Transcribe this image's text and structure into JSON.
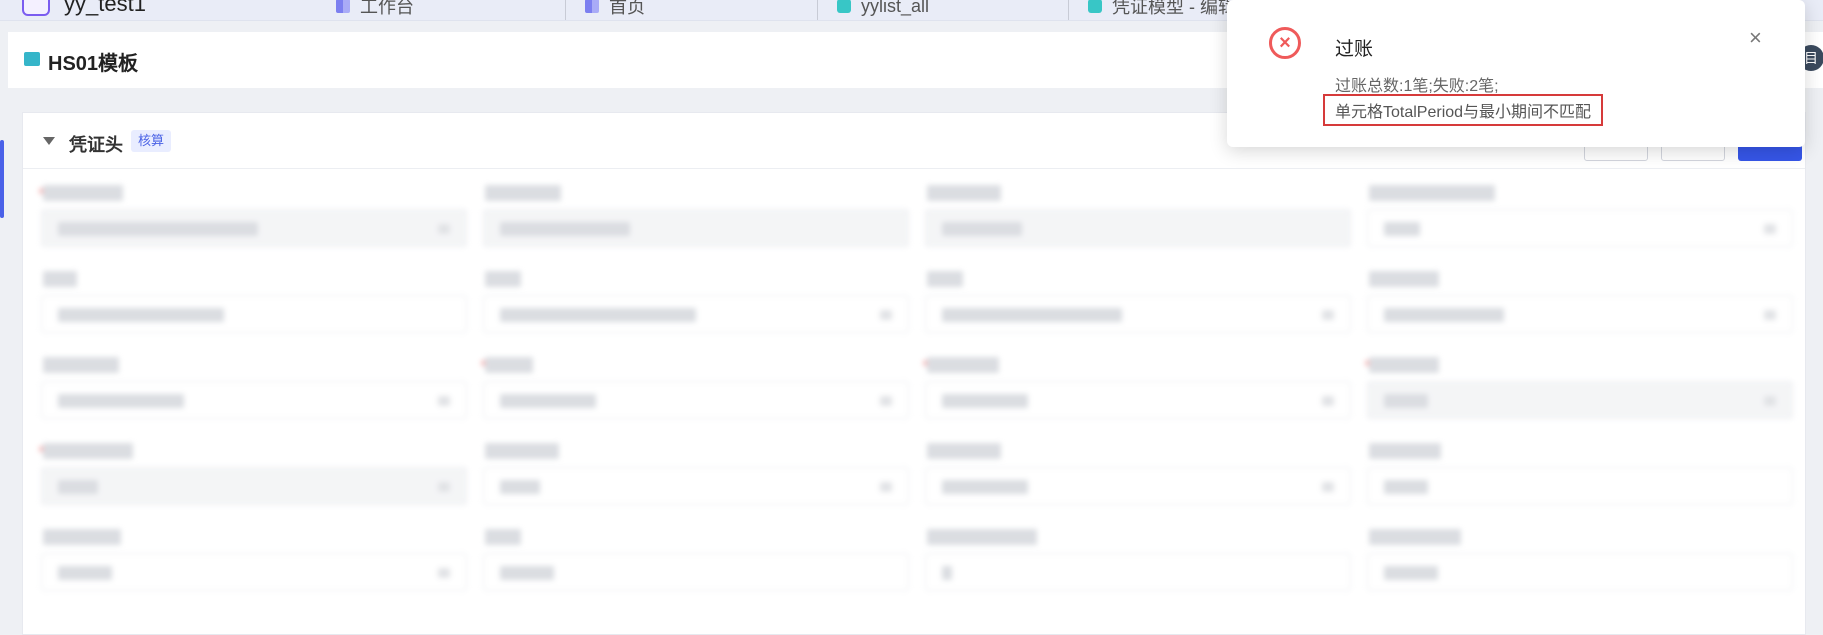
{
  "app": {
    "name": "yy_test1"
  },
  "tabs": [
    {
      "label": "工作台",
      "icon": "dashboard-icon"
    },
    {
      "label": "首页",
      "icon": "home-icon"
    },
    {
      "label": "yylist_all",
      "icon": "list-icon"
    },
    {
      "label": "凭证模型 - 编辑",
      "icon": "model-icon"
    }
  ],
  "page": {
    "title": "HS01模板"
  },
  "header_right": {
    "label": "目"
  },
  "section": {
    "title": "凭证头",
    "tag": "核算"
  },
  "notification": {
    "title": "过账",
    "line1": "过账总数:1笔;失败:2笔;",
    "line2": "单元格TotalPeriod与最小期间不匹配",
    "close": "×",
    "icon_symbol": "×",
    "status_color": "#ef5a5a"
  },
  "colors": {
    "accent": "#3656e8",
    "error": "#ef5a5a",
    "tag_bg": "#e9edff"
  }
}
